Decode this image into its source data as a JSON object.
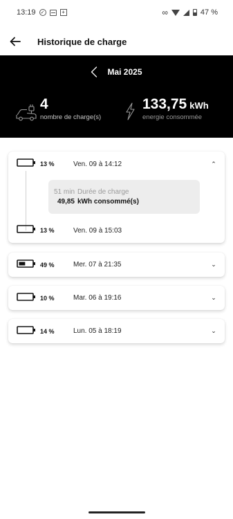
{
  "status_bar": {
    "time": "13:19",
    "battery": "47 %"
  },
  "app_bar": {
    "title": "Historique de charge"
  },
  "summary": {
    "month": "Mai 2025",
    "count_value": "4",
    "count_label": "nombre de charge(s)",
    "energy_value": "133,75",
    "energy_unit": "kWh",
    "energy_label": "energie consommée"
  },
  "sessions": [
    {
      "percent": "13 %",
      "date": "Ven. 09 à 14:12",
      "expanded": true,
      "battery_level": 0.13,
      "details": [
        {
          "value": "51 min",
          "label": "Durée de charge"
        },
        {
          "value": "49,85",
          "label": "kWh consommé(s)"
        }
      ],
      "end": {
        "percent": "13 %",
        "date": "Ven. 09 à 15:03",
        "battery_level": 0.13
      }
    },
    {
      "percent": "49 %",
      "date": "Mer. 07 à 21:35",
      "expanded": false,
      "battery_level": 0.49
    },
    {
      "percent": "10 %",
      "date": "Mar. 06 à 19:16",
      "expanded": false,
      "battery_level": 0.1
    },
    {
      "percent": "14 %",
      "date": "Lun. 05 à 18:19",
      "expanded": false,
      "battery_level": 0.14
    }
  ],
  "colors": {
    "header_bg": "#000000",
    "detail_bg": "#ededed",
    "muted_text": "#9a9a9a"
  }
}
